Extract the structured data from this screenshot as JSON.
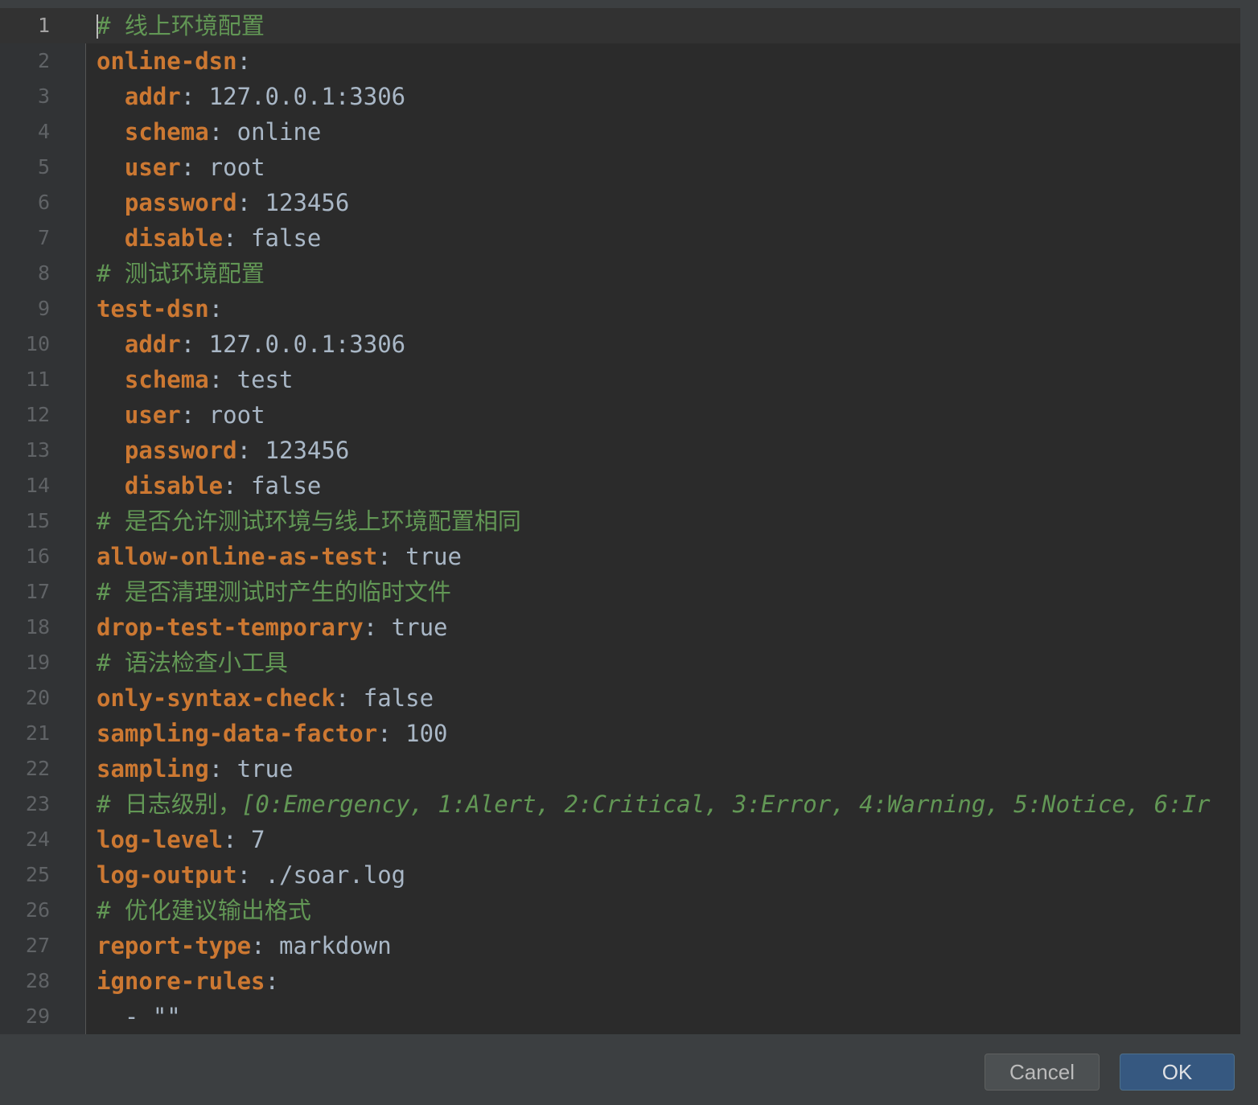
{
  "editor": {
    "lines": [
      {
        "num": "1",
        "parts": [
          {
            "t": "# 线上环境配置",
            "c": "comment"
          }
        ]
      },
      {
        "num": "2",
        "parts": [
          {
            "t": "online-dsn",
            "c": "key"
          },
          {
            "t": ":",
            "c": "val"
          }
        ]
      },
      {
        "num": "3",
        "parts": [
          {
            "t": "  ",
            "c": "val"
          },
          {
            "t": "addr",
            "c": "key"
          },
          {
            "t": ": 127.0.0.1:3306",
            "c": "val"
          }
        ]
      },
      {
        "num": "4",
        "parts": [
          {
            "t": "  ",
            "c": "val"
          },
          {
            "t": "schema",
            "c": "key"
          },
          {
            "t": ": online",
            "c": "val"
          }
        ]
      },
      {
        "num": "5",
        "parts": [
          {
            "t": "  ",
            "c": "val"
          },
          {
            "t": "user",
            "c": "key"
          },
          {
            "t": ": root",
            "c": "val"
          }
        ]
      },
      {
        "num": "6",
        "parts": [
          {
            "t": "  ",
            "c": "val"
          },
          {
            "t": "password",
            "c": "key"
          },
          {
            "t": ": 123456",
            "c": "val"
          }
        ]
      },
      {
        "num": "7",
        "parts": [
          {
            "t": "  ",
            "c": "val"
          },
          {
            "t": "disable",
            "c": "key"
          },
          {
            "t": ": false",
            "c": "val"
          }
        ]
      },
      {
        "num": "8",
        "parts": [
          {
            "t": "# 测试环境配置",
            "c": "comment"
          }
        ]
      },
      {
        "num": "9",
        "parts": [
          {
            "t": "test-dsn",
            "c": "key"
          },
          {
            "t": ":",
            "c": "val"
          }
        ]
      },
      {
        "num": "10",
        "parts": [
          {
            "t": "  ",
            "c": "val"
          },
          {
            "t": "addr",
            "c": "key"
          },
          {
            "t": ": 127.0.0.1:3306",
            "c": "val"
          }
        ]
      },
      {
        "num": "11",
        "parts": [
          {
            "t": "  ",
            "c": "val"
          },
          {
            "t": "schema",
            "c": "key"
          },
          {
            "t": ": test",
            "c": "val"
          }
        ]
      },
      {
        "num": "12",
        "parts": [
          {
            "t": "  ",
            "c": "val"
          },
          {
            "t": "user",
            "c": "key"
          },
          {
            "t": ": root",
            "c": "val"
          }
        ]
      },
      {
        "num": "13",
        "parts": [
          {
            "t": "  ",
            "c": "val"
          },
          {
            "t": "password",
            "c": "key"
          },
          {
            "t": ": 123456",
            "c": "val"
          }
        ]
      },
      {
        "num": "14",
        "parts": [
          {
            "t": "  ",
            "c": "val"
          },
          {
            "t": "disable",
            "c": "key"
          },
          {
            "t": ": false",
            "c": "val"
          }
        ]
      },
      {
        "num": "15",
        "parts": [
          {
            "t": "# 是否允许测试环境与线上环境配置相同",
            "c": "comment"
          }
        ]
      },
      {
        "num": "16",
        "parts": [
          {
            "t": "allow-online-as-test",
            "c": "key"
          },
          {
            "t": ": true",
            "c": "val"
          }
        ]
      },
      {
        "num": "17",
        "parts": [
          {
            "t": "# 是否清理测试时产生的临时文件",
            "c": "comment"
          }
        ]
      },
      {
        "num": "18",
        "parts": [
          {
            "t": "drop-test-temporary",
            "c": "key"
          },
          {
            "t": ": true",
            "c": "val"
          }
        ]
      },
      {
        "num": "19",
        "parts": [
          {
            "t": "# 语法检查小工具",
            "c": "comment"
          }
        ]
      },
      {
        "num": "20",
        "parts": [
          {
            "t": "only-syntax-check",
            "c": "key"
          },
          {
            "t": ": false",
            "c": "val"
          }
        ]
      },
      {
        "num": "21",
        "parts": [
          {
            "t": "sampling-data-factor",
            "c": "key"
          },
          {
            "t": ": 100",
            "c": "val"
          }
        ]
      },
      {
        "num": "22",
        "parts": [
          {
            "t": "sampling",
            "c": "key"
          },
          {
            "t": ": true",
            "c": "val"
          }
        ]
      },
      {
        "num": "23",
        "parts": [
          {
            "t": "# 日志级别，",
            "c": "comment"
          },
          {
            "t": "[0:Emergency, 1:Alert, 2:Critical, 3:Error, 4:Warning, 5:Notice, 6:Ir",
            "c": "comment-it"
          }
        ]
      },
      {
        "num": "24",
        "parts": [
          {
            "t": "log-level",
            "c": "key"
          },
          {
            "t": ": 7",
            "c": "val"
          }
        ]
      },
      {
        "num": "25",
        "parts": [
          {
            "t": "log-output",
            "c": "key"
          },
          {
            "t": ": ./soar.log",
            "c": "val"
          }
        ]
      },
      {
        "num": "26",
        "parts": [
          {
            "t": "# 优化建议输出格式",
            "c": "comment"
          }
        ]
      },
      {
        "num": "27",
        "parts": [
          {
            "t": "report-type",
            "c": "key"
          },
          {
            "t": ": markdown",
            "c": "val"
          }
        ]
      },
      {
        "num": "28",
        "parts": [
          {
            "t": "ignore-rules",
            "c": "key"
          },
          {
            "t": ":",
            "c": "val"
          }
        ]
      },
      {
        "num": "29",
        "parts": [
          {
            "t": "  - \"\"",
            "c": "val"
          }
        ]
      }
    ],
    "current_line": 1
  },
  "buttons": {
    "cancel_label": "Cancel",
    "ok_label": "OK"
  },
  "colors": {
    "background": "#2b2b2b",
    "key": "#cc7832",
    "value": "#a9b7c6",
    "comment": "#629755",
    "ok_button": "#365880"
  }
}
